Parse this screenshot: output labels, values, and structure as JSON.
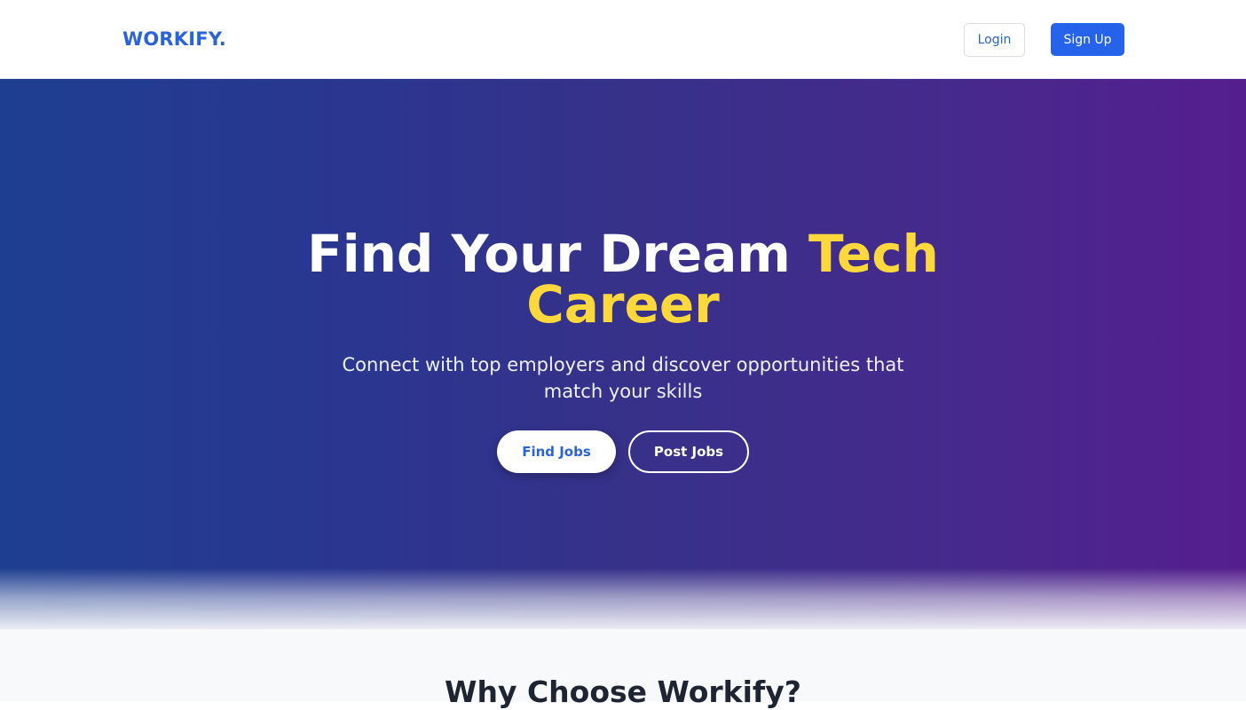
{
  "header": {
    "logo": "WORKIFY.",
    "login_label": "Login",
    "signup_label": "Sign Up"
  },
  "hero": {
    "title_main": "Find Your Dream ",
    "title_accent_1": "Tech",
    "title_accent_2": "Career",
    "subtitle": "Connect with top employers and discover opportunities that match your skills",
    "find_jobs_label": "Find Jobs",
    "post_jobs_label": "Post Jobs"
  },
  "why": {
    "title": "Why Choose Workify?"
  },
  "colors": {
    "brand_blue": "#2563eb",
    "accent_yellow": "#fcd83c",
    "hero_gradient_start": "#1e3f91",
    "hero_gradient_end": "#551e8e"
  }
}
